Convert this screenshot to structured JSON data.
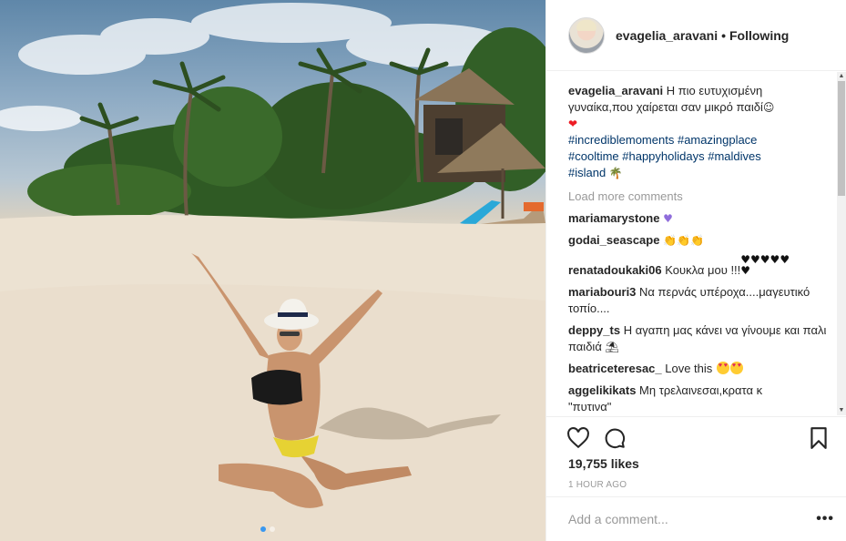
{
  "post": {
    "username": "evagelia_aravani",
    "follow_separator": "•",
    "follow_status": "Following",
    "image_alt": "",
    "carousel_total": 2,
    "carousel_active": 1
  },
  "caption": {
    "username": "evagelia_aravani",
    "text": " Η πιο ευτυχισμένη γυναίκα,που χαίρεται σαν μικρό παιδί",
    "hashtags": [
      "#incrediblemoments",
      "#amazingplace",
      "#cooltime",
      "#happyholidays",
      "#maldives",
      "#island"
    ]
  },
  "load_more": "Load more comments",
  "comments": [
    {
      "username": "mariamarystone",
      "text": ""
    },
    {
      "username": "godai_seascape",
      "text": ""
    },
    {
      "username": "renatadoukaki06",
      "text": " Κουκλα μου !!!"
    },
    {
      "username": "mariabouri3",
      "text": " Να περνάς υπέροχα....μαγευτικό τοπίο...."
    },
    {
      "username": "deppy_ts",
      "text": " Η αγαπη μας κάνει να γίνουμε και παλι παιδιά"
    },
    {
      "username": "beatriceteresac_",
      "text": " Love this"
    },
    {
      "username": "aggelikikats",
      "text": " Μη τρελαινεσαι,κρατα κ"
    },
    {
      "username": "",
      "text": "\"πυτινα\""
    }
  ],
  "actions": {
    "likes": "19,755 likes",
    "time": "1 HOUR AGO"
  },
  "add_comment": {
    "placeholder": "Add a comment...",
    "more": "•••"
  },
  "icons": {
    "like": "heart-outline-icon",
    "comment": "comment-bubble-icon",
    "save": "bookmark-icon",
    "more": "more-options-icon"
  },
  "colors": {
    "hashtag": "#003569",
    "muted": "#999999",
    "active_dot": "#3897f0",
    "heart_red": "#ed1c24"
  }
}
